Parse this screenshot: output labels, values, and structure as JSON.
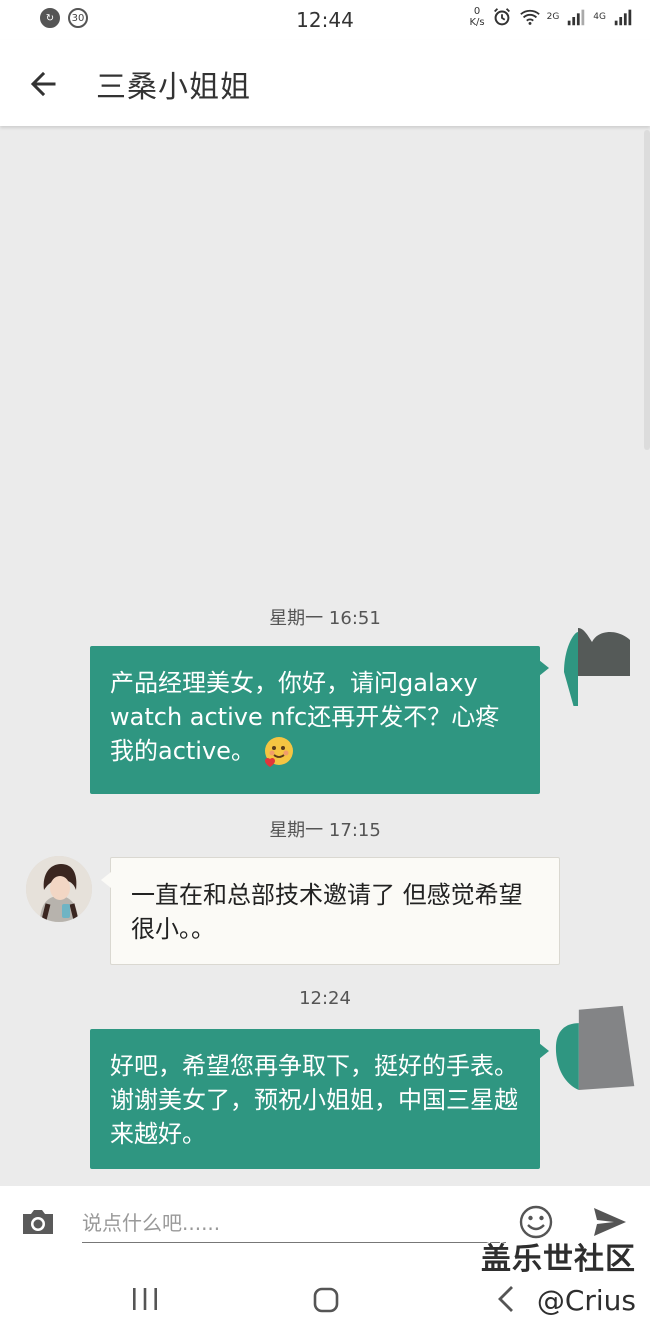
{
  "status_bar": {
    "left_badge": "30",
    "time": "12:44",
    "net_speed_value": "0",
    "net_speed_unit": "K/s",
    "sim1_tag": "2G",
    "sim2_tag": "4G"
  },
  "app_bar": {
    "title": "三桑小姐姐"
  },
  "messages": [
    {
      "timestamp": "星期一 16:51",
      "direction": "outgoing",
      "text": "产品经理美女，你好，请问galaxy watch active nfc还再开发不？心疼我的active。",
      "emoji": "hugging-heart-emoji"
    },
    {
      "timestamp": "星期一 17:15",
      "direction": "incoming",
      "text": "一直在和总部技术邀请了 但感觉希望很小。。"
    },
    {
      "timestamp": "12:24",
      "direction": "outgoing",
      "text": "好吧，希望您再争取下，挺好的手表。谢谢美女了，预祝小姐姐，中国三星越来越好。"
    }
  ],
  "input_bar": {
    "placeholder": "说点什么吧......"
  },
  "watermark": {
    "line1": "盖乐世社区",
    "line2": "@Crius"
  },
  "colors": {
    "outgoing_bubble": "#2f9681",
    "incoming_bubble": "#fbfaf6",
    "background": "#ebebeb"
  }
}
